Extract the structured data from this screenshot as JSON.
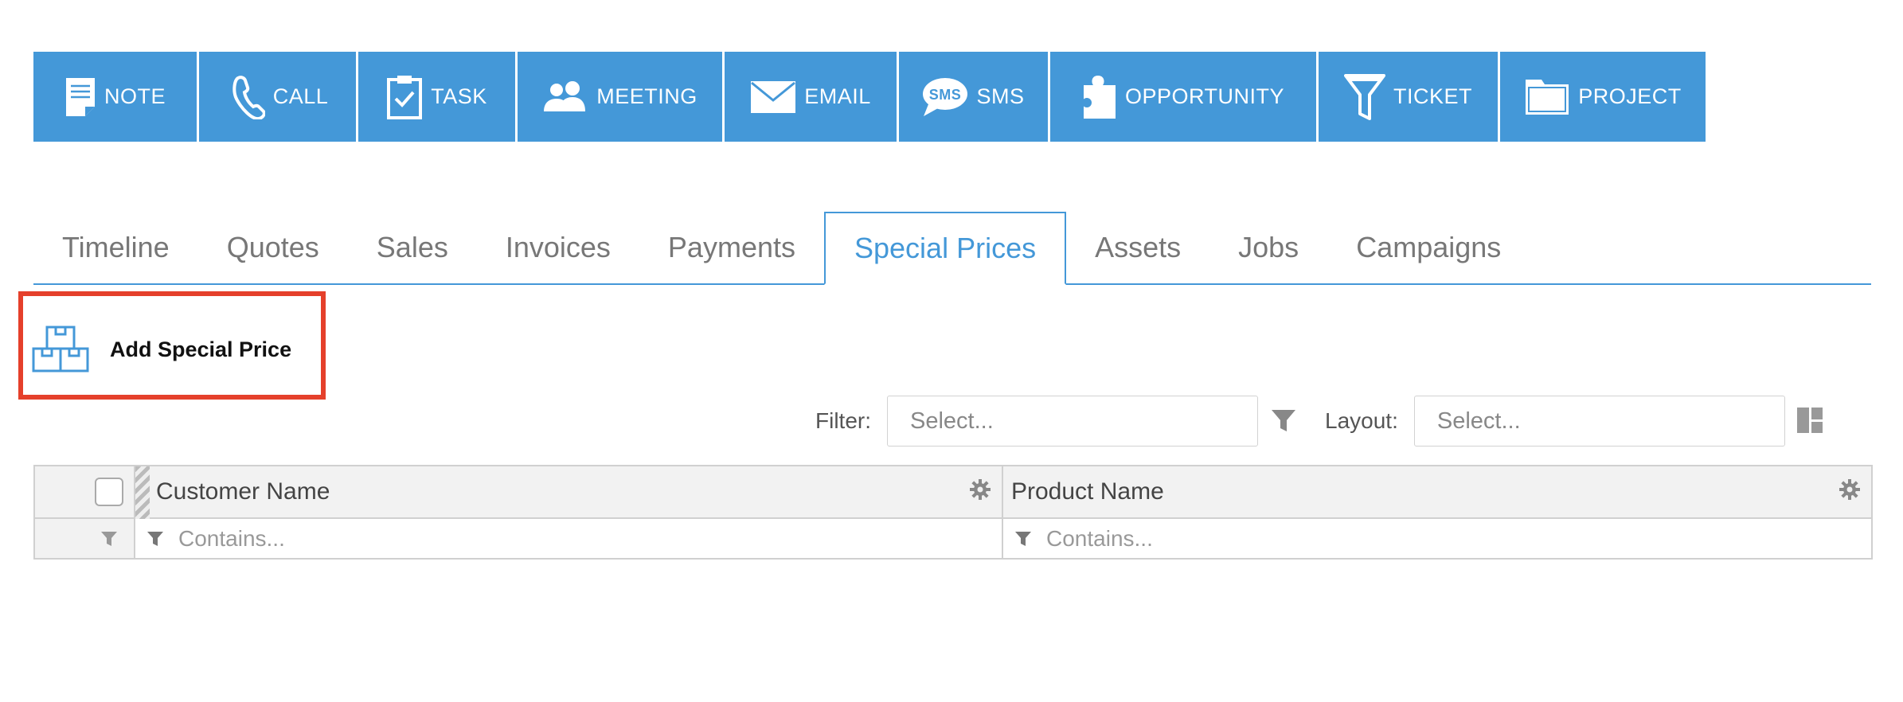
{
  "toolbar": {
    "buttons": [
      {
        "label": "NOTE",
        "icon": "note-icon"
      },
      {
        "label": "CALL",
        "icon": "phone-icon"
      },
      {
        "label": "TASK",
        "icon": "clipboard-check-icon"
      },
      {
        "label": "MEETING",
        "icon": "people-icon"
      },
      {
        "label": "EMAIL",
        "icon": "envelope-icon"
      },
      {
        "label": "SMS",
        "icon": "sms-bubble-icon"
      },
      {
        "label": "OPPORTUNITY",
        "icon": "puzzle-icon"
      },
      {
        "label": "TICKET",
        "icon": "funnel-icon"
      },
      {
        "label": "PROJECT",
        "icon": "folder-icon"
      }
    ],
    "color": "#4498d8"
  },
  "tabs": {
    "items": [
      "Timeline",
      "Quotes",
      "Sales",
      "Invoices",
      "Payments",
      "Special Prices",
      "Assets",
      "Jobs",
      "Campaigns"
    ],
    "active": "Special Prices"
  },
  "actions": {
    "add_label": "Add Special Price",
    "add_icon": "boxes-icon",
    "highlight_color": "#e5402b"
  },
  "filters": {
    "filter_label": "Filter:",
    "filter_placeholder": "Select...",
    "layout_label": "Layout:",
    "layout_placeholder": "Select..."
  },
  "grid": {
    "columns": [
      "Customer Name",
      "Product Name"
    ],
    "filter_placeholder": "Contains..."
  }
}
